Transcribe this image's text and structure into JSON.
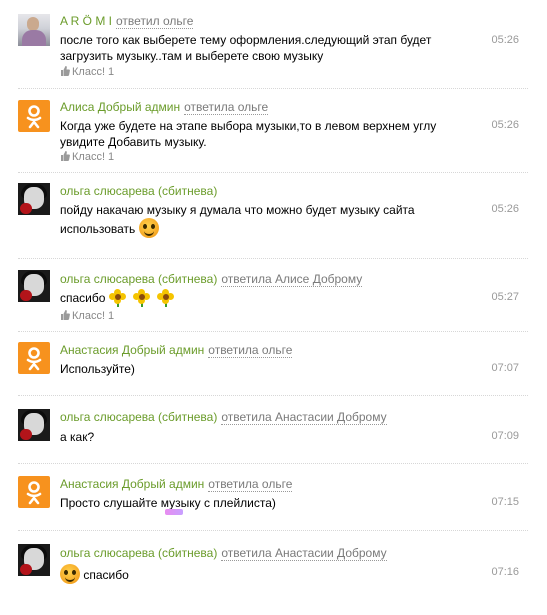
{
  "messages": [
    {
      "author": "A R Ö M I",
      "reply": "ответил ольге",
      "text": "после того как выберете тему оформления.следующий этап будет загрузить музыку..там и выберете свою музыку",
      "time": "05:26",
      "klass": "Класс! 1",
      "avatar": "photo"
    },
    {
      "author": "Алиса Добрый админ",
      "reply": "ответила ольге",
      "text": "Когда уже будете на этапе выбора музыки,то в левом верхнем углу увидите Добавить музыку.",
      "time": "05:26",
      "klass": "Класс! 1",
      "avatar": "ok"
    },
    {
      "author": "ольга слюсарева (сбитнева)",
      "reply": "",
      "text": "пойду накачаю музыку я думала что можно будет музыку сайта использовать",
      "time": "05:26",
      "klass": "",
      "avatar": "dark"
    },
    {
      "author": "ольга слюсарева (сбитнева)",
      "reply": "ответила Алисе Доброму",
      "text": "спасибо",
      "time": "05:27",
      "klass": "Класс! 1",
      "avatar": "dark"
    },
    {
      "author": "Анастасия Добрый админ",
      "reply": "ответила ольге",
      "text": "Используйте)",
      "time": "07:07",
      "klass": "",
      "avatar": "ok"
    },
    {
      "author": "ольга слюсарева (сбитнева)",
      "reply": "ответила Анастасии Доброму",
      "text": "а как?",
      "time": "07:09",
      "klass": "",
      "avatar": "dark"
    },
    {
      "author": "Анастасия Добрый админ",
      "reply": "ответила ольге",
      "text": "Просто слушайте музыку с плейлиста)",
      "time": "07:15",
      "klass": "",
      "avatar": "ok"
    },
    {
      "author": "ольга слюсарева (сбитнева)",
      "reply": "ответила Анастасии Доброму",
      "text": "спасибо",
      "time": "07:16",
      "klass": "",
      "avatar": "dark"
    }
  ],
  "icons": {
    "avatar_ok": "odnoklassniki-logo-icon",
    "thumb": "thumb-up-icon",
    "smiley": "smiley-icon",
    "flower": "flower-icon"
  },
  "colors": {
    "author": "#6b9c2b",
    "reply": "#7a7a7a",
    "time": "#999999",
    "ok_orange": "#f7921e"
  }
}
